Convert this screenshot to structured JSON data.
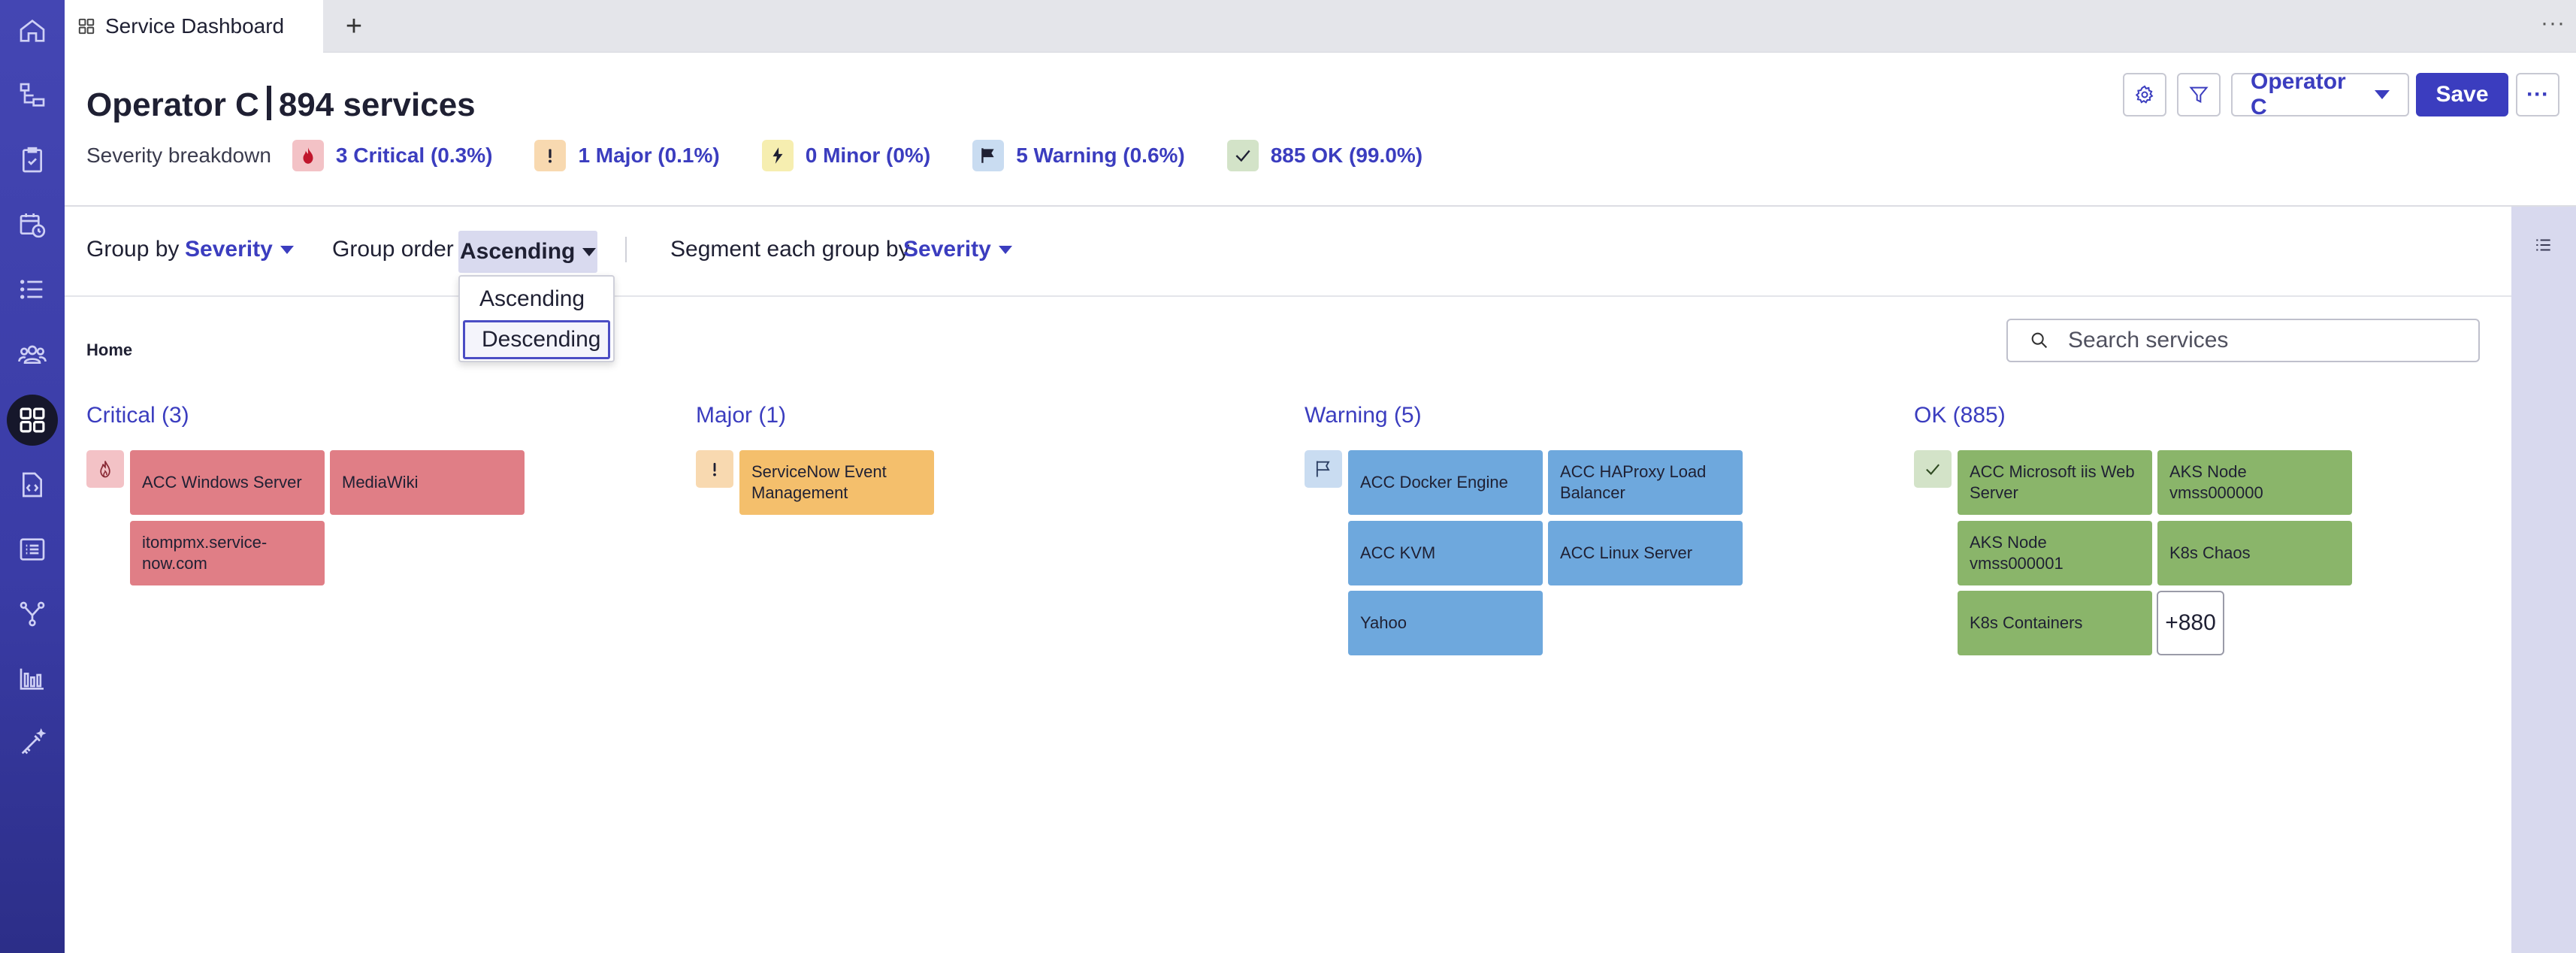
{
  "tab": {
    "label": "Service Dashboard",
    "add": "+",
    "more": "···"
  },
  "header": {
    "operator": "Operator C",
    "service_count": "894 services",
    "breakdown_label": "Severity breakdown",
    "severities": [
      {
        "label": "3 Critical (0.3%)",
        "icon": "flame-icon",
        "color": "#f3c2c6"
      },
      {
        "label": "1 Major (0.1%)",
        "icon": "exclamation-icon",
        "color": "#f8d9b0"
      },
      {
        "label": "0 Minor (0%)",
        "icon": "bolt-icon",
        "color": "#f6eeb0"
      },
      {
        "label": "5 Warning (0.6%)",
        "icon": "flag-icon",
        "color": "#c9dcf1"
      },
      {
        "label": "885 OK (99.0%)",
        "icon": "check-icon",
        "color": "#d3e3c8"
      }
    ],
    "operator_button": "Operator C",
    "save_label": "Save",
    "more_label": "···"
  },
  "toolbar": {
    "group_by_label": "Group by",
    "group_by_value": "Severity",
    "group_order_label": "Group order",
    "group_order_value": "Ascending",
    "segment_label": "Segment each group by",
    "segment_value": "Severity"
  },
  "dropdown": {
    "options": [
      "Ascending",
      "Descending"
    ],
    "highlighted": "Descending"
  },
  "breadcrumb": "Home",
  "search": {
    "placeholder": "Search services"
  },
  "groups": [
    {
      "title": "Critical (3)",
      "icon": "flame-icon",
      "tiles": [
        "ACC Windows Server",
        "MediaWiki",
        "itompmx.service-now.com"
      ]
    },
    {
      "title": "Major (1)",
      "icon": "exclamation-icon",
      "tiles": [
        "ServiceNow Event Management"
      ]
    },
    {
      "title": "Warning (5)",
      "icon": "flag-icon",
      "tiles": [
        "ACC Docker Engine",
        "ACC HAProxy Load Balancer",
        "ACC KVM",
        "ACC Linux Server",
        "Yahoo"
      ]
    },
    {
      "title": "OK (885)",
      "icon": "check-icon",
      "tiles": [
        "ACC Microsoft iis Web Server",
        "AKS Node vmss000000",
        "AKS Node vmss000001",
        "K8s Chaos",
        "K8s Containers"
      ],
      "more": "+880"
    }
  ],
  "colors": {
    "accent": "#3b3dbf",
    "nav": "#4446b3",
    "critical": "#e07e86",
    "major": "#f4bf6c",
    "warning": "#6ea8dd",
    "ok": "#8ab56a"
  }
}
